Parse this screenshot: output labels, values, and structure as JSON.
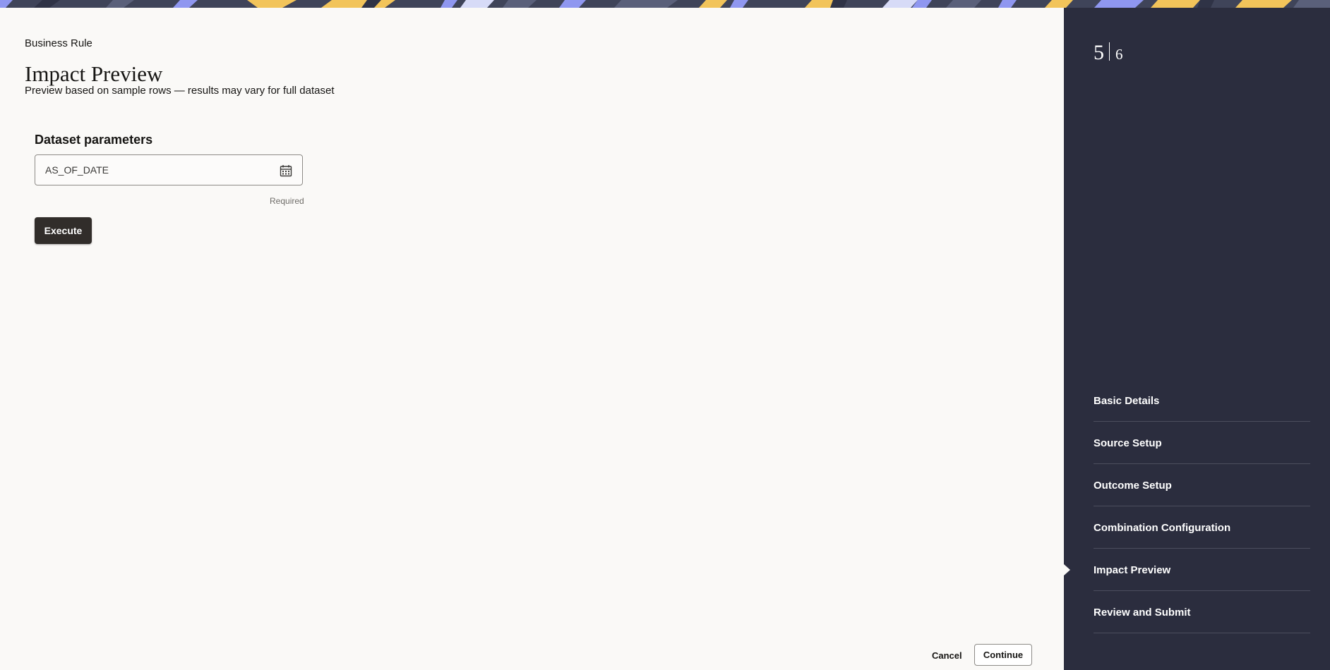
{
  "header": {
    "eyebrow": "Business Rule",
    "title": "Impact Preview",
    "subtitle": "Preview based on sample rows — results may vary for full dataset"
  },
  "parameters": {
    "section_title": "Dataset parameters",
    "date_field": {
      "placeholder": "AS_OF_DATE",
      "value": "",
      "helper": "Required",
      "icon": "calendar-icon"
    },
    "execute_label": "Execute"
  },
  "footer": {
    "cancel_label": "Cancel",
    "continue_label": "Continue"
  },
  "progress": {
    "current": "5",
    "total": "6"
  },
  "steps": [
    {
      "label": "Basic Details"
    },
    {
      "label": "Source Setup"
    },
    {
      "label": "Outcome Setup"
    },
    {
      "label": "Combination Configuration"
    },
    {
      "label": "Impact Preview",
      "active": true
    },
    {
      "label": "Review and Submit"
    }
  ],
  "colors": {
    "panel_bg": "#2b2d3e",
    "page_bg": "#faf9f7",
    "primary_button": "#312d2a",
    "banner_accent_yellow": "#f2c45a",
    "banner_accent_blue": "#8f97f0"
  }
}
